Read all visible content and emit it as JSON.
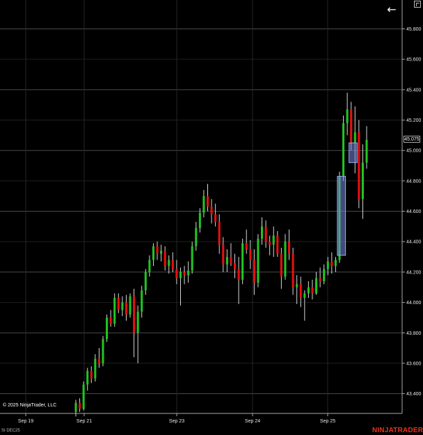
{
  "chart_data": {
    "type": "candlestick",
    "instrument": "SI DEC25",
    "y_axis": {
      "ticks": [
        "45.800",
        "45.600",
        "45.400",
        "45.200",
        "45.000",
        "44.800",
        "44.600",
        "44.400",
        "44.200",
        "44.000",
        "43.800",
        "43.600",
        "43.400"
      ],
      "range": [
        43.27,
        45.99
      ]
    },
    "x_axis": {
      "labels": [
        "Sep 19",
        "Sep 21",
        "Sep 23",
        "Sep 24",
        "Sep 25"
      ]
    },
    "grid": true,
    "last_price": "45.075",
    "colors": {
      "up": "#21c521",
      "down": "#e8100f",
      "grid": "#3a3a3a",
      "zone_fill": "#7788dd",
      "zone_stroke": "#99aaff"
    },
    "zones": [
      {
        "price_low": 44.31,
        "price_high": 44.83
      },
      {
        "price_low": 44.92,
        "price_high": 45.05
      }
    ],
    "candles": [
      [
        43.28,
        43.36,
        43.25,
        43.34
      ],
      [
        43.34,
        43.37,
        43.28,
        43.3
      ],
      [
        43.3,
        43.48,
        43.29,
        43.46
      ],
      [
        43.46,
        43.57,
        43.42,
        43.55
      ],
      [
        43.55,
        43.58,
        43.47,
        43.5
      ],
      [
        43.5,
        43.66,
        43.48,
        43.63
      ],
      [
        43.63,
        43.7,
        43.57,
        43.6
      ],
      [
        43.6,
        43.78,
        43.58,
        43.76
      ],
      [
        43.76,
        43.92,
        43.74,
        43.9
      ],
      [
        43.9,
        43.95,
        43.84,
        43.86
      ],
      [
        43.86,
        44.06,
        43.84,
        44.03
      ],
      [
        44.03,
        44.06,
        43.93,
        43.95
      ],
      [
        43.95,
        44.04,
        43.91,
        44.0
      ],
      [
        44.0,
        44.05,
        43.88,
        43.92
      ],
      [
        43.92,
        44.06,
        43.9,
        44.04
      ],
      [
        44.04,
        44.09,
        43.64,
        43.8
      ],
      [
        43.8,
        43.98,
        43.6,
        43.94
      ],
      [
        43.94,
        44.11,
        43.9,
        44.08
      ],
      [
        44.08,
        44.22,
        44.05,
        44.2
      ],
      [
        44.2,
        44.31,
        44.17,
        44.28
      ],
      [
        44.28,
        44.39,
        44.24,
        44.37
      ],
      [
        44.37,
        44.4,
        44.28,
        44.32
      ],
      [
        44.32,
        44.38,
        44.27,
        44.34
      ],
      [
        44.34,
        44.37,
        44.21,
        44.24
      ],
      [
        44.24,
        44.31,
        44.19,
        44.28
      ],
      [
        44.28,
        44.33,
        44.2,
        44.22
      ],
      [
        44.22,
        44.28,
        44.12,
        44.16
      ],
      [
        44.16,
        44.23,
        43.98,
        44.2
      ],
      [
        44.2,
        44.24,
        44.12,
        44.18
      ],
      [
        44.18,
        44.27,
        44.13,
        44.21
      ],
      [
        44.21,
        44.4,
        44.19,
        44.37
      ],
      [
        44.37,
        44.53,
        44.34,
        44.49
      ],
      [
        44.49,
        44.62,
        44.46,
        44.59
      ],
      [
        44.59,
        44.74,
        44.56,
        44.7
      ],
      [
        44.7,
        44.78,
        44.6,
        44.63
      ],
      [
        44.63,
        44.68,
        44.52,
        44.58
      ],
      [
        44.58,
        44.65,
        44.5,
        44.53
      ],
      [
        44.53,
        44.58,
        44.32,
        44.38
      ],
      [
        44.38,
        44.43,
        44.2,
        44.25
      ],
      [
        44.25,
        44.35,
        44.2,
        44.3
      ],
      [
        44.3,
        44.39,
        44.24,
        44.26
      ],
      [
        44.26,
        44.32,
        44.16,
        44.22
      ],
      [
        44.22,
        44.3,
        43.99,
        44.15
      ],
      [
        44.15,
        44.42,
        44.12,
        44.39
      ],
      [
        44.39,
        44.48,
        44.32,
        44.35
      ],
      [
        44.35,
        44.41,
        44.22,
        44.28
      ],
      [
        44.28,
        44.35,
        44.05,
        44.13
      ],
      [
        44.13,
        44.45,
        44.1,
        44.42
      ],
      [
        44.42,
        44.56,
        44.38,
        44.5
      ],
      [
        44.5,
        44.54,
        44.36,
        44.4
      ],
      [
        44.4,
        44.44,
        44.31,
        44.38
      ],
      [
        44.38,
        44.5,
        44.3,
        44.44
      ],
      [
        44.44,
        44.47,
        44.3,
        44.32
      ],
      [
        44.32,
        44.36,
        44.09,
        44.17
      ],
      [
        44.17,
        44.45,
        44.15,
        44.4
      ],
      [
        44.4,
        44.48,
        44.28,
        44.32
      ],
      [
        44.32,
        44.36,
        44.05,
        44.1
      ],
      [
        44.1,
        44.18,
        43.99,
        44.12
      ],
      [
        44.12,
        44.17,
        43.97,
        44.03
      ],
      [
        44.03,
        44.08,
        43.88,
        44.06
      ],
      [
        44.06,
        44.14,
        44.03,
        44.1
      ],
      [
        44.1,
        44.15,
        44.02,
        44.06
      ],
      [
        44.06,
        44.2,
        44.05,
        44.16
      ],
      [
        44.16,
        44.23,
        44.1,
        44.14
      ],
      [
        44.14,
        44.25,
        44.12,
        44.22
      ],
      [
        44.22,
        44.3,
        44.18,
        44.27
      ],
      [
        44.27,
        44.33,
        44.19,
        44.24
      ],
      [
        44.24,
        44.3,
        44.2,
        44.28
      ],
      [
        44.28,
        44.86,
        44.26,
        44.83
      ],
      [
        44.83,
        45.23,
        44.8,
        45.18
      ],
      [
        45.18,
        45.38,
        45.1,
        45.27
      ],
      [
        45.27,
        45.32,
        45.0,
        45.05
      ],
      [
        45.05,
        45.29,
        44.85,
        45.12
      ],
      [
        45.12,
        45.2,
        44.62,
        44.68
      ],
      [
        44.68,
        45.04,
        44.55,
        44.92
      ],
      [
        44.92,
        45.16,
        44.88,
        45.07
      ]
    ]
  },
  "controls": {
    "back_arrow": "←"
  },
  "footer": {
    "copyright": "© 2025 NinjaTrader, LLC",
    "instrument": "SI DEC25",
    "brand": "NINJATRADER"
  }
}
